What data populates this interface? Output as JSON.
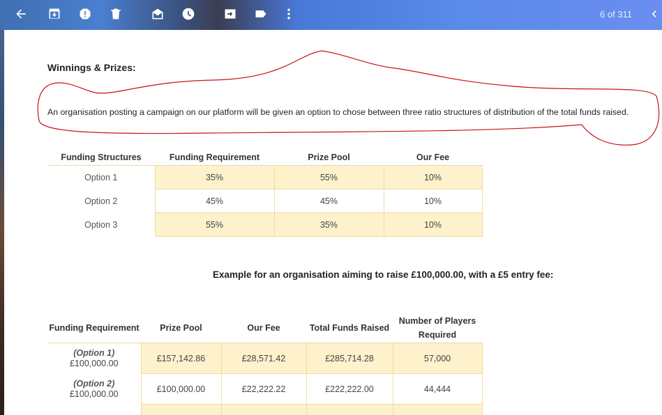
{
  "toolbar": {
    "icons": [
      "back-arrow-icon",
      "archive-icon",
      "report-spam-icon",
      "delete-icon",
      "mark-unread-icon",
      "snooze-icon",
      "move-to-icon",
      "label-icon",
      "more-vert-icon",
      "chevron-left-icon"
    ],
    "page_count": "6 of 311"
  },
  "email": {
    "heading": "Winnings & Prizes:",
    "intro": "An organisation posting a campaign on our platform will be given an option to chose between three ratio structures of distribution of the total funds raised.",
    "structures_table": {
      "headers": [
        "Funding Structures",
        "Funding Requirement",
        "Prize Pool",
        "Our Fee"
      ],
      "rows": [
        [
          "Option 1",
          "35%",
          "55%",
          "10%"
        ],
        [
          "Option 2",
          "45%",
          "45%",
          "10%"
        ],
        [
          "Option 3",
          "55%",
          "35%",
          "10%"
        ]
      ]
    },
    "example_caption": "Example for an organisation aiming to raise £100,000.00, with a £5 entry fee:",
    "example_table": {
      "headers": [
        "Funding Requirement",
        "Prize Pool",
        "Our Fee",
        "Total Funds Raised",
        "Number of Players Required"
      ],
      "rows": [
        {
          "option": "(Option 1)",
          "amount": "£100,000.00",
          "values": [
            "£157,142.86",
            "£28,571.42",
            "£285,714.28",
            "57,000"
          ]
        },
        {
          "option": "(Option 2)",
          "amount": "£100,000.00",
          "values": [
            "£100,000.00",
            "£22,222.22",
            "£222,222.00",
            "44,444"
          ]
        }
      ]
    }
  },
  "colors": {
    "table_shade": "#fdf2cc",
    "table_border": "#f0dc9c",
    "annotation": "#c8101a"
  }
}
